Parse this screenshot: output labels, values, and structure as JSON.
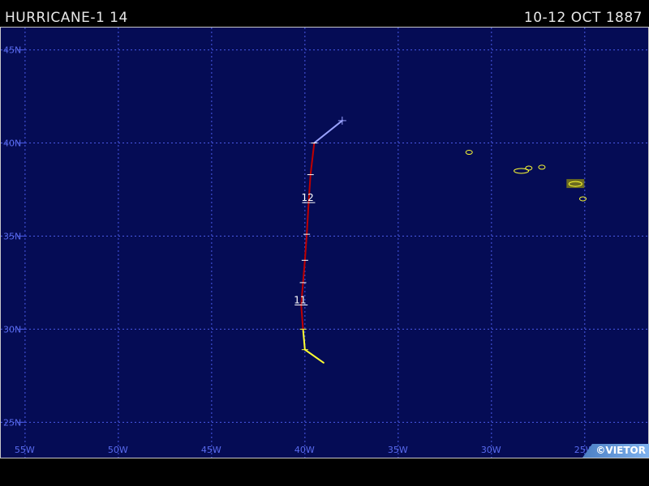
{
  "header": {
    "title": "HURRICANE-1 14",
    "dates": "10-12 OCT 1887"
  },
  "credit": "©VIETOR",
  "map": {
    "lon_min": -56.3,
    "lon_max": -21.6,
    "lat_min": 23.1,
    "lat_max": 46.2,
    "grid": true,
    "lat_lines": [
      25,
      30,
      35,
      40,
      45
    ],
    "lon_lines": [
      -55,
      -50,
      -45,
      -40,
      -35,
      -30,
      -25
    ],
    "lat_labels": [
      "25N",
      "30N",
      "35N",
      "40N",
      "45N"
    ],
    "lon_labels": [
      "55W",
      "50W",
      "45W",
      "40W",
      "35W",
      "30W",
      "25W"
    ],
    "colors": {
      "ocean": "#050c55",
      "grid": "#4a5ae8",
      "tropical_storm": "#ffff33",
      "hurricane_cat1": "#c00000",
      "extratropical": "#9aa2ff",
      "land": "#ffff33"
    },
    "track": [
      {
        "lat": 28.2,
        "lon": -39.0,
        "status": "tropical_storm"
      },
      {
        "lat": 28.9,
        "lon": -40.0,
        "status": "tropical_storm"
      },
      {
        "lat": 30.0,
        "lon": -40.1,
        "status": "tropical_storm"
      },
      {
        "lat": 31.3,
        "lon": -40.2,
        "status": "hurricane_cat1",
        "day": "11"
      },
      {
        "lat": 32.5,
        "lon": -40.1,
        "status": "hurricane_cat1"
      },
      {
        "lat": 33.7,
        "lon": -40.0,
        "status": "hurricane_cat1"
      },
      {
        "lat": 35.1,
        "lon": -39.9,
        "status": "hurricane_cat1"
      },
      {
        "lat": 36.8,
        "lon": -39.8,
        "status": "hurricane_cat1",
        "day": "12"
      },
      {
        "lat": 38.3,
        "lon": -39.7,
        "status": "hurricane_cat1"
      },
      {
        "lat": 40.0,
        "lon": -39.5,
        "status": "hurricane_cat1"
      },
      {
        "lat": 41.2,
        "lon": -38.0,
        "status": "extratropical"
      }
    ],
    "islands": [
      {
        "name": "Corvo-Flores",
        "lat": 39.5,
        "lon": -31.2
      },
      {
        "name": "Faial-Pico",
        "lat": 38.5,
        "lon": -28.4
      },
      {
        "name": "Sao Jorge",
        "lat": 38.65,
        "lon": -28.0
      },
      {
        "name": "Terceira",
        "lat": 38.7,
        "lon": -27.3
      },
      {
        "name": "Sao Miguel",
        "lat": 37.8,
        "lon": -25.5
      },
      {
        "name": "Santa Maria",
        "lat": 37.0,
        "lon": -25.1
      }
    ]
  }
}
